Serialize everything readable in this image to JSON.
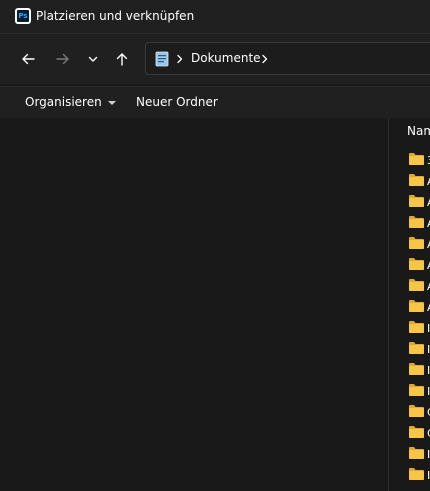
{
  "window": {
    "title": "Platzieren und verknüpfen",
    "app_icon_text": "Ps"
  },
  "navigation": {
    "back": "back-arrow-icon",
    "forward": "forward-arrow-icon",
    "recent": "chevron-down-icon",
    "up": "up-arrow-icon"
  },
  "address_bar": {
    "location_icon": "documents-icon",
    "path": [
      "Dokumente"
    ]
  },
  "command_bar": {
    "organize_label": "Organisieren",
    "new_folder_label": "Neuer Ordner"
  },
  "file_list": {
    "name_column_header": "Nam",
    "rows": [
      {
        "icon": "folder-icon",
        "name": "3"
      },
      {
        "icon": "folder-icon",
        "name": "A"
      },
      {
        "icon": "folder-icon",
        "name": "A"
      },
      {
        "icon": "folder-icon",
        "name": "A"
      },
      {
        "icon": "folder-icon",
        "name": "A"
      },
      {
        "icon": "folder-icon",
        "name": "A"
      },
      {
        "icon": "folder-icon",
        "name": "A"
      },
      {
        "icon": "folder-icon",
        "name": "A"
      },
      {
        "icon": "folder-icon",
        "name": "I"
      },
      {
        "icon": "folder-icon",
        "name": "I"
      },
      {
        "icon": "folder-icon",
        "name": "I"
      },
      {
        "icon": "folder-icon",
        "name": "I"
      },
      {
        "icon": "folder-icon",
        "name": "C"
      },
      {
        "icon": "folder-icon",
        "name": "C"
      },
      {
        "icon": "folder-icon",
        "name": "I"
      },
      {
        "icon": "folder-icon",
        "name": "I"
      }
    ]
  },
  "colors": {
    "background": "#191919",
    "chrome": "#202020",
    "text": "#ffffff",
    "folder": "#f8c646",
    "folder_tab": "#e0a82e"
  }
}
